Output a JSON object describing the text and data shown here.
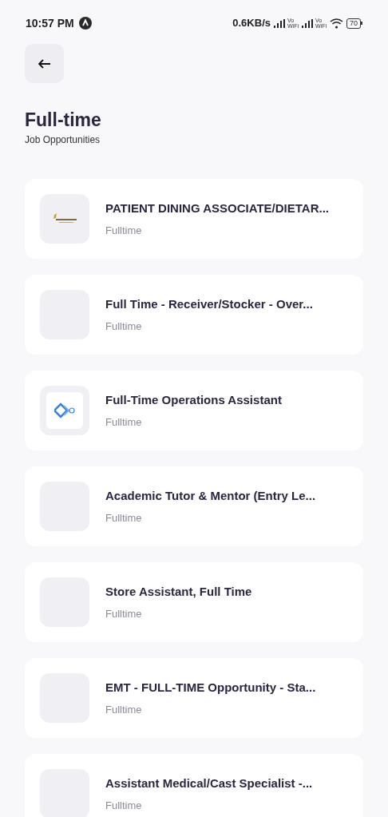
{
  "status_bar": {
    "time": "10:57 PM",
    "speed": "0.6KB/s",
    "volte": [
      {
        "top": "Vo",
        "bottom": "WiFi"
      },
      {
        "top": "Vo",
        "bottom": "WiFi"
      }
    ],
    "battery": "70"
  },
  "header": {
    "title": "Full-time",
    "subtitle": "Job Opportunities"
  },
  "jobs": [
    {
      "title": "PATIENT DINING ASSOCIATE/DIETAR...",
      "type": "Fulltime",
      "kind": "compass"
    },
    {
      "title": "Full Time - Receiver/Stocker - Over...",
      "type": "Fulltime",
      "kind": "blank"
    },
    {
      "title": "Full-Time Operations Assistant",
      "type": "Fulltime",
      "kind": "job"
    },
    {
      "title": "Academic Tutor & Mentor (Entry Le...",
      "type": "Fulltime",
      "kind": "blank"
    },
    {
      "title": "Store Assistant, Full Time",
      "type": "Fulltime",
      "kind": "blank"
    },
    {
      "title": "EMT - FULL-TIME Opportunity - Sta...",
      "type": "Fulltime",
      "kind": "blank"
    },
    {
      "title": "Assistant Medical/Cast Specialist -...",
      "type": "Fulltime",
      "kind": "blank"
    }
  ]
}
